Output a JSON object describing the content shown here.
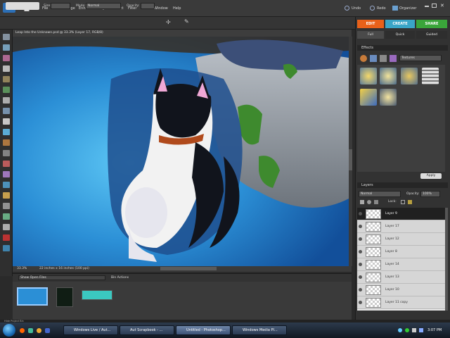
{
  "app": {
    "logo_text": "PSE"
  },
  "menu": {
    "items": [
      "File",
      "Edit",
      "Image",
      "Enhance",
      "Layer",
      "Select",
      "Filter",
      "View",
      "Window",
      "Help"
    ],
    "undo_label": "Undo",
    "redo_label": "Redo",
    "organizer_label": "Organizer"
  },
  "options_bar": {
    "size_label": "Size:",
    "size_value": "",
    "mode_label": "Mode:",
    "mode_value": "Normal",
    "opacity_label": "Opacity:",
    "opacity_value": ""
  },
  "document": {
    "title": "Leap Into the Unknown.psd @ 33.3% (Layer 17, RGB/8)",
    "zoom": "33.3%",
    "doc_info": "22 inches x 16 inches (100 ppi)"
  },
  "project_bin": {
    "dropdown_value": "Show Open Files",
    "actions_label": "Bin Actions"
  },
  "mode_tabs": [
    {
      "label": "EDIT",
      "color": "#e8611a"
    },
    {
      "label": "CREATE",
      "color": "#3aa5c7"
    },
    {
      "label": "SHARE",
      "color": "#3aa53a"
    }
  ],
  "edit_subtabs": [
    "Full",
    "Quick",
    "Guided"
  ],
  "effects_panel": {
    "title": "Effects",
    "filter_dropdown": "Textures",
    "apply_label": "Apply"
  },
  "layers_panel": {
    "title": "Layers",
    "blend_mode": "Normal",
    "opacity_label": "Opacity:",
    "opacity_value": "100%",
    "lock_label": "Lock:",
    "layers": [
      {
        "name": "Layer 9",
        "selected": true
      },
      {
        "name": "Layer 17",
        "selected": false
      },
      {
        "name": "Layer 12",
        "selected": false
      },
      {
        "name": "Layer 8",
        "selected": false
      },
      {
        "name": "Layer 14",
        "selected": false
      },
      {
        "name": "Layer 13",
        "selected": false
      },
      {
        "name": "Layer 10",
        "selected": false
      },
      {
        "name": "Layer 11 copy",
        "selected": false
      }
    ]
  },
  "status_bar": {
    "text": "Hide Project Bin"
  },
  "taskbar": {
    "tasks": [
      {
        "label": "Windows Live / Aut...",
        "active": false
      },
      {
        "label": "Aut Scrapbook - ...",
        "active": false
      },
      {
        "label": "Untitled - Photoshop...",
        "active": true
      },
      {
        "label": "Windows Media Pl...",
        "active": false
      }
    ],
    "clock": "3:07 PM"
  },
  "colors": {
    "accent_edit": "#e8611a",
    "canvas_water": "#2b8fd6",
    "selected_layer": "#202020"
  }
}
